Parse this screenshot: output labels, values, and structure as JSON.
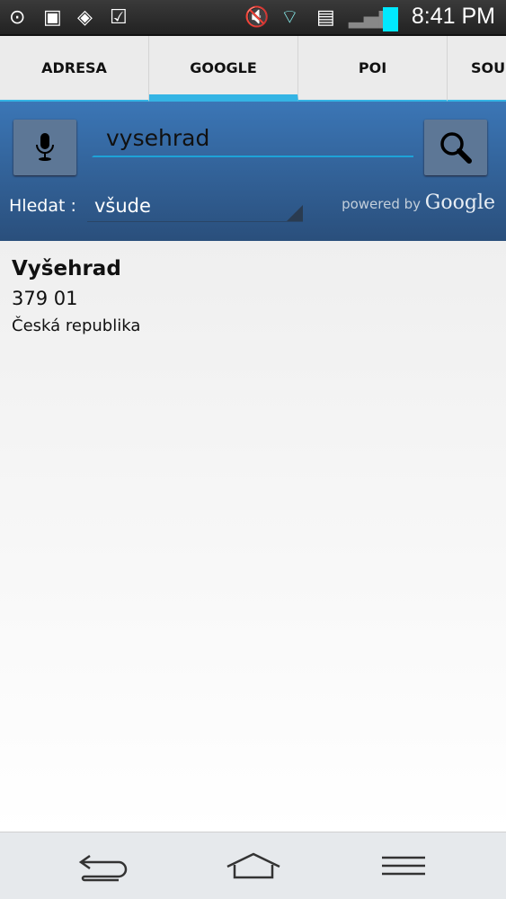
{
  "status_bar": {
    "time": "8:41 PM",
    "icons": [
      "gps-icon",
      "gallery-icon",
      "app-icon",
      "shopping-bag-icon",
      "mute-icon",
      "wifi-icon",
      "sim-error-icon",
      "signal-none-icon",
      "battery-icon"
    ]
  },
  "tabs": [
    {
      "label": "ADRESA"
    },
    {
      "label": "GOOGLE",
      "active": true
    },
    {
      "label": "POI"
    },
    {
      "label": "SOU"
    }
  ],
  "search": {
    "value": "vysehrad",
    "scope_label": "Hledat :",
    "scope_value": "všude",
    "powered_by": "powered by",
    "brand": "Google"
  },
  "result": {
    "name": "Vyšehrad",
    "postcode": "379 01",
    "country": "Česká republika"
  },
  "colors": {
    "accent": "#34b4e4",
    "header": "#3b76b6"
  }
}
